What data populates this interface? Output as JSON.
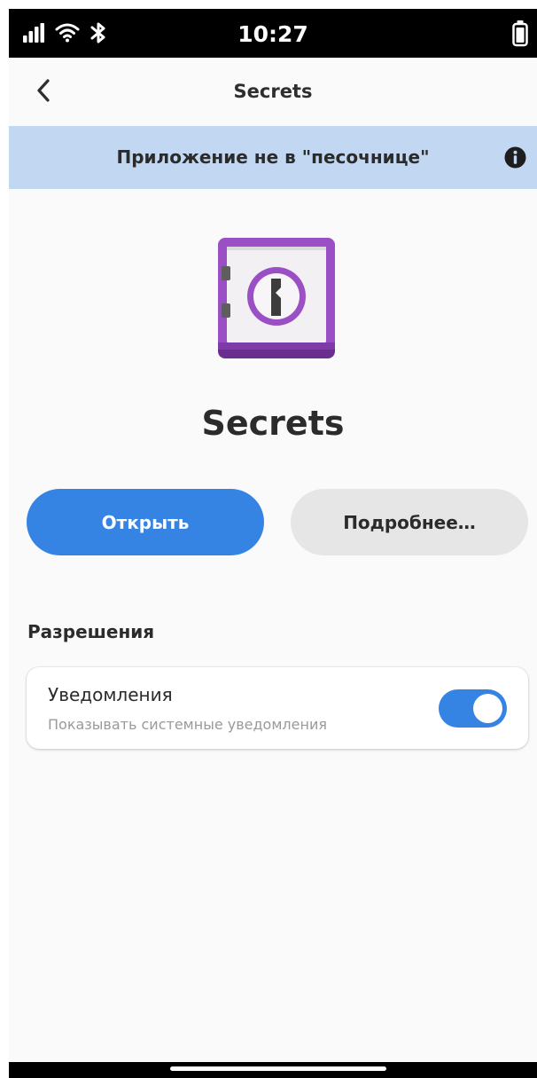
{
  "status_bar": {
    "time": "10:27",
    "icons": [
      "signal-icon",
      "wifi-icon",
      "bluetooth-icon",
      "battery-icon"
    ]
  },
  "header": {
    "title": "Secrets",
    "back_icon": "chevron-left-icon"
  },
  "banner": {
    "text": "Приложение не в \"песочнице\"",
    "icon": "info-icon",
    "background": "#c2d8f2"
  },
  "app": {
    "name": "Secrets",
    "icon": "vault-icon",
    "accent": "#9b4fc4"
  },
  "actions": {
    "open_label": "Открыть",
    "more_label": "Подробнее…",
    "primary_color": "#3584e4"
  },
  "permissions": {
    "section_title": "Разрешения",
    "items": [
      {
        "title": "Уведомления",
        "subtitle": "Показывать системные уведомления",
        "enabled": true
      }
    ]
  }
}
